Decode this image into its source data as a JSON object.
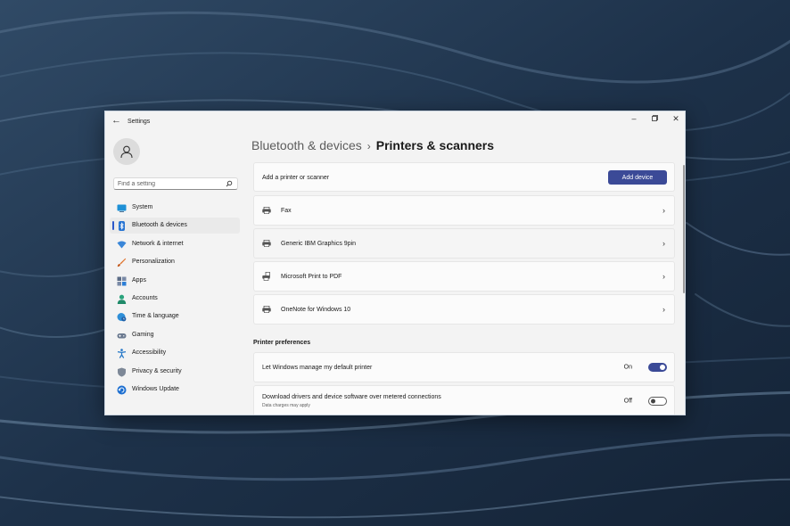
{
  "window": {
    "title": "Settings"
  },
  "sidebar": {
    "search_placeholder": "Find a setting",
    "items": [
      {
        "label": "System",
        "icon": "monitor-icon",
        "active": false
      },
      {
        "label": "Bluetooth & devices",
        "icon": "bluetooth-icon",
        "active": true
      },
      {
        "label": "Network & internet",
        "icon": "wifi-icon",
        "active": false
      },
      {
        "label": "Personalization",
        "icon": "brush-icon",
        "active": false
      },
      {
        "label": "Apps",
        "icon": "apps-icon",
        "active": false
      },
      {
        "label": "Accounts",
        "icon": "person-icon",
        "active": false
      },
      {
        "label": "Time & language",
        "icon": "globe-clock-icon",
        "active": false
      },
      {
        "label": "Gaming",
        "icon": "controller-icon",
        "active": false
      },
      {
        "label": "Accessibility",
        "icon": "accessibility-icon",
        "active": false
      },
      {
        "label": "Privacy & security",
        "icon": "shield-icon",
        "active": false
      },
      {
        "label": "Windows Update",
        "icon": "update-icon",
        "active": false
      }
    ]
  },
  "header": {
    "parent": "Bluetooth & devices",
    "separator": "›",
    "current": "Printers & scanners"
  },
  "add_row": {
    "label": "Add a printer or scanner",
    "button": "Add device"
  },
  "printers": [
    {
      "name": "Fax"
    },
    {
      "name": "Generic IBM Graphics 9pin"
    },
    {
      "name": "Microsoft Print to PDF"
    },
    {
      "name": "OneNote for Windows 10"
    }
  ],
  "preferences": {
    "title": "Printer preferences",
    "items": [
      {
        "label": "Let Windows manage my default printer",
        "sublabel": "",
        "state": "On",
        "on": true
      },
      {
        "label": "Download drivers and device software over metered connections",
        "sublabel": "Data charges may apply",
        "state": "Off",
        "on": false
      }
    ]
  },
  "colors": {
    "accent": "#3b4a97",
    "nav_indicator": "#2b57c9",
    "window_bg": "#f3f3f3",
    "wallpaper": "#1c2f45"
  }
}
